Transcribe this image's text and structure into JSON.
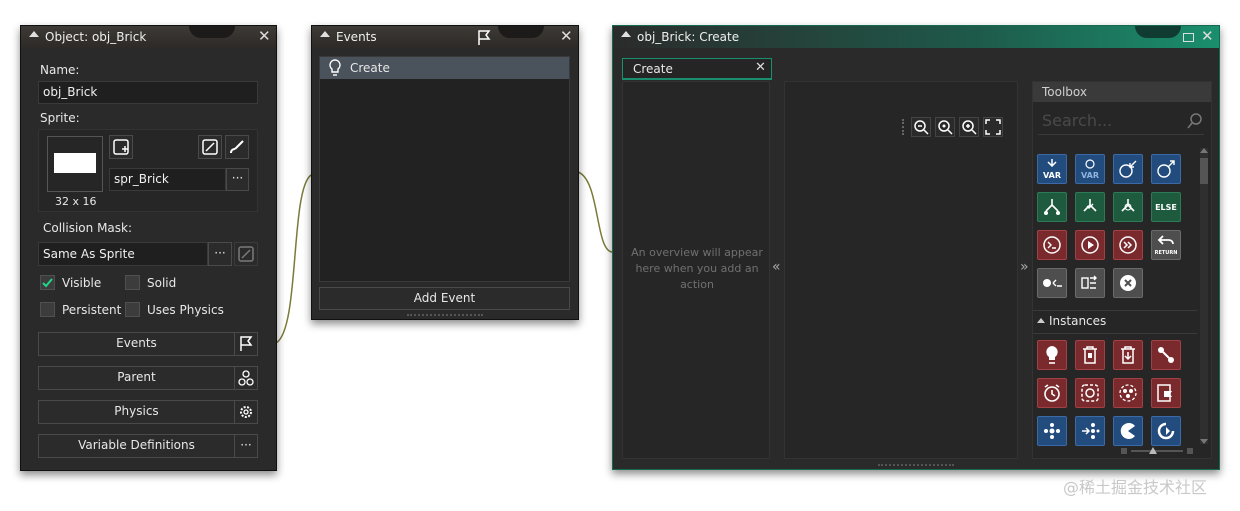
{
  "object_window": {
    "title": "Object: obj_Brick",
    "name_label": "Name:",
    "name_value": "obj_Brick",
    "sprite_label": "Sprite:",
    "sprite_size": "32 x 16",
    "sprite_name": "spr_Brick",
    "more": "···",
    "collision_label": "Collision Mask:",
    "collision_value": "Same As Sprite",
    "visible_label": "Visible",
    "solid_label": "Solid",
    "persistent_label": "Persistent",
    "uses_physics_label": "Uses Physics",
    "events_label": "Events",
    "parent_label": "Parent",
    "physics_label": "Physics",
    "variable_definitions_label": "Variable Definitions"
  },
  "events_window": {
    "title": "Events",
    "events": [
      "Create"
    ],
    "add_event_label": "Add Event"
  },
  "code_window": {
    "title": "obj_Brick: Create",
    "tab_label": "Create",
    "overview_text": "An overview will appear here when you add an action",
    "collapse_left": "«",
    "collapse_right": "»",
    "toolbox_label": "Toolbox",
    "search_placeholder": "Search...",
    "instances_label": "Instances",
    "tile_texts": {
      "var": "VAR",
      "else": "ELSE",
      "return": "RETURN"
    }
  },
  "watermark": "@稀土掘金技术社区",
  "colors": {
    "accent_green": "#1a8f6d",
    "tile_blue": "#234c7e",
    "tile_green": "#1e5a3e",
    "tile_red": "#7a2a2c",
    "tile_gray": "#4e4e4e"
  }
}
